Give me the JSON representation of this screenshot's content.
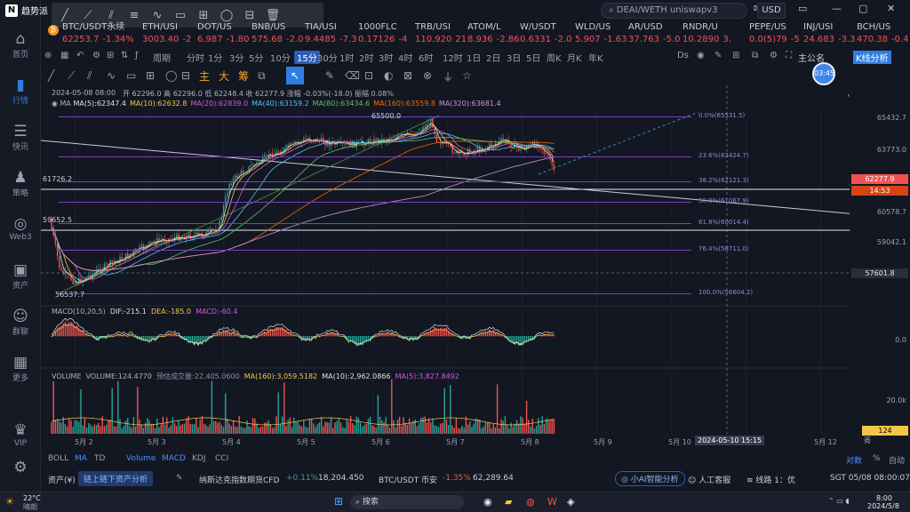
{
  "app": {
    "logo_text": "趋势派"
  },
  "sidebar": {
    "items": [
      {
        "icon": "home-icon",
        "glyph": "⌂",
        "label": "首页",
        "active": false
      },
      {
        "icon": "chart-icon",
        "glyph": "▮",
        "label": "行情",
        "active": true
      },
      {
        "icon": "news-icon",
        "glyph": "☰",
        "label": "快讯",
        "active": false
      },
      {
        "icon": "strategy-icon",
        "glyph": "♟",
        "label": "策略",
        "active": false
      },
      {
        "icon": "web3-icon",
        "glyph": "◎",
        "label": "Web3",
        "active": false
      },
      {
        "icon": "wallet-icon",
        "glyph": "▣",
        "label": "资产",
        "active": false
      },
      {
        "icon": "community-icon",
        "glyph": "☺",
        "label": "群聊",
        "active": false
      },
      {
        "icon": "more-icon",
        "glyph": "▦",
        "label": "更多",
        "active": false
      },
      {
        "icon": "vip-icon",
        "glyph": "♛",
        "label": "VIP",
        "active": false
      },
      {
        "icon": "settings-icon",
        "glyph": "⚙",
        "label": "",
        "active": false
      }
    ]
  },
  "search": {
    "placeholder": "DEAI/WETH uniswapv3"
  },
  "header": {
    "currency": "USD"
  },
  "tickers": [
    {
      "symbol": "BTC/USDT永续",
      "price": "62253.7",
      "change": "-1.34%",
      "dir": "neg"
    },
    {
      "symbol": "ETH/USI",
      "price": "3003.40",
      "change": "-2",
      "dir": "neg"
    },
    {
      "symbol": "DOT/US",
      "price": "6.987",
      "change": "-1.80",
      "dir": "neg"
    },
    {
      "symbol": "BNB/US",
      "price": "575.68",
      "change": "-2.0",
      "dir": "neg"
    },
    {
      "symbol": "TIA/USI",
      "price": "9.4485",
      "change": "-7.3",
      "dir": "neg"
    },
    {
      "symbol": "1000FLC",
      "price": "0.17126",
      "change": "-4",
      "dir": "neg"
    },
    {
      "symbol": "TRB/USI",
      "price": "110.920",
      "change": "21",
      "dir": "neg"
    },
    {
      "symbol": "ATOM/L",
      "price": "8.936",
      "change": "-2.86",
      "dir": "neg"
    },
    {
      "symbol": "W/USDT",
      "price": "0.6331",
      "change": "-2.0",
      "dir": "neg"
    },
    {
      "symbol": "WLD/US",
      "price": "5.907",
      "change": "-1.63",
      "dir": "neg"
    },
    {
      "symbol": "AR/USD",
      "price": "37.763",
      "change": "-5.0",
      "dir": "neg"
    },
    {
      "symbol": "RNDR/U",
      "price": "10.2890",
      "change": "3.",
      "dir": "neg"
    },
    {
      "symbol": "PEPE/US",
      "price": "0.0(5)79",
      "change": "-5",
      "dir": "neg"
    },
    {
      "symbol": "INJ/USI",
      "price": "24.683",
      "change": "-3.3",
      "dir": "neg"
    },
    {
      "symbol": "BCH/US",
      "price": "470.38",
      "change": "-0.4",
      "dir": "neg"
    }
  ],
  "toolbar": {
    "period_label": "周期",
    "intervals": [
      "分时",
      "1分",
      "3分",
      "5分",
      "10分",
      "15分",
      "30分",
      "1时",
      "2时",
      "3时",
      "4时",
      "6时",
      "12时",
      "1日",
      "2日",
      "3日",
      "5日",
      "周K",
      "月K",
      "年K"
    ],
    "active_interval": "15分",
    "ds_label": "Ds",
    "time_badge": "03:45",
    "theme_label": "主公名",
    "ai_button": "K线分析"
  },
  "drawing": {
    "labels": [
      "主",
      "大",
      "筹"
    ]
  },
  "chart": {
    "date_line": "2024-05-08 08:00",
    "ohlc": "开 62296.0  高 62296.0  低 62248.4  收 62277.9  涨幅 -0.03%(-18.0)  振幅 0.08%",
    "ma_line": [
      {
        "text": "MA(5):62347.4",
        "color": "#e0e0e0"
      },
      {
        "text": "MA(10):62632.8",
        "color": "#f5c64a"
      },
      {
        "text": "MA(20):62839.0",
        "color": "#d05ce3"
      },
      {
        "text": "MA(40):63159.2",
        "color": "#4fc3f7"
      },
      {
        "text": "MA(80):63434.6",
        "color": "#66bb6a"
      },
      {
        "text": "MA(160):63559.8",
        "color": "#ef6c00"
      },
      {
        "text": "MA(320):63681.4",
        "color": "#ce93d8"
      }
    ],
    "price_labels": [
      "65500.0",
      "61726.2",
      "59652.5",
      "56537.7"
    ],
    "fib": [
      "0.0%(65531.5)",
      "23.6%(63424.7)",
      "38.2%(62121.3)",
      "50.0%(61067.9)",
      "61.8%(60014.4)",
      "76.4%(58711.0)",
      "100.0%(56604.2)"
    ],
    "y_labels": [
      "65432.7",
      "63773.0",
      "62277.9",
      "60578.7",
      "59042.1",
      "57601.8"
    ],
    "price_badge": "62277.9",
    "timer_badge": "14:53",
    "crosshair_price": "57601.8",
    "macd": {
      "title": "MACD(10,20,5)",
      "dif": "DIF:-215.1",
      "dea": "DEA:-185.0",
      "macd": "MACD:-60.4",
      "zero": "0.0"
    },
    "volume": {
      "title": "VOLUME",
      "vol": "VOLUME:124.4770",
      "turnover": "预估成交量:22,405.0600",
      "ma160": "MA(160):3,059.5182",
      "ma10": "MA(10):2,962.0866",
      "ma5": "MA(5):3,827.8492",
      "y_top": "20.0k",
      "last": "124"
    },
    "x_labels": [
      "5月 2",
      "5月 3",
      "5月 4",
      "5月 5",
      "5月 6",
      "5月 7",
      "5月 8",
      "5月 9",
      "5月 10",
      "5月 12"
    ],
    "x_cursor": "2024-05-10 15:15",
    "x_tail": [
      "1",
      "莠"
    ]
  },
  "bottom_tabs": {
    "left": [
      "BOLL",
      "MA",
      "TD",
      "Volume",
      "MACD",
      "KDJ",
      "CCI"
    ],
    "right": [
      "对数",
      "%",
      "自动"
    ]
  },
  "status": {
    "assets": "资产(¥)",
    "analysis_button": "链上链下资产分析",
    "news": "纳斯达克指数期货CFD",
    "news_change": "+0.11%",
    "news_value": "18,204.450",
    "pair": "BTC/USDT 币安",
    "pair_change": "-1.35%",
    "pair_price": "62,289.64",
    "ai_analysis": "小AI智能分析",
    "service": "人工客服",
    "line": "线路 1：优",
    "time": "SGT 05/08 08:00:07"
  },
  "taskbar": {
    "weather_temp": "22°C",
    "weather_text": "晴朗",
    "search": "搜索",
    "clock": "8:00",
    "date": "2024/5/8"
  }
}
